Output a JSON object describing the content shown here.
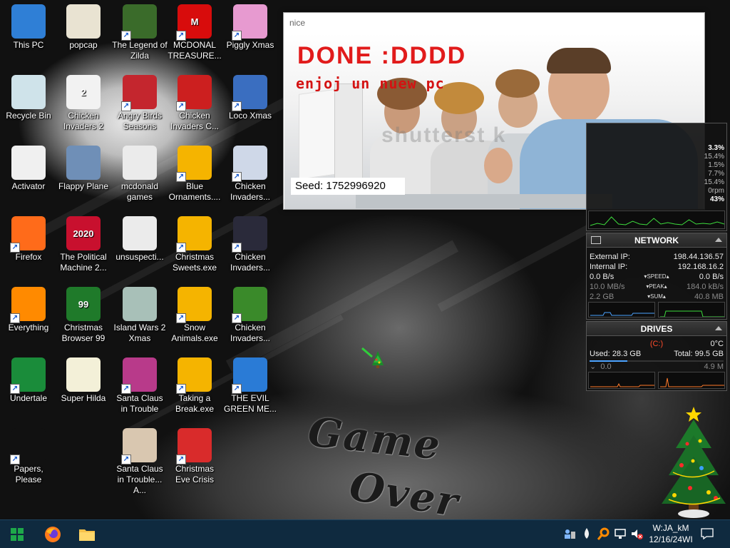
{
  "desktop": {
    "icons": [
      {
        "label": "This PC",
        "icon": "computer-icon",
        "color": "#2f7fd6",
        "glyph": "",
        "shortcut": false
      },
      {
        "label": "Recycle Bin",
        "icon": "recycle-bin-icon",
        "color": "#cfe3ea",
        "glyph": "",
        "shortcut": false
      },
      {
        "label": "Activator",
        "icon": "folder-icon",
        "color": "#f0f0f0",
        "glyph": "",
        "shortcut": false
      },
      {
        "label": "Firefox",
        "icon": "firefox-icon",
        "color": "#ff6b1a",
        "glyph": "",
        "shortcut": true
      },
      {
        "label": "Everything",
        "icon": "search-icon",
        "color": "#ff8a00",
        "glyph": "",
        "shortcut": true
      },
      {
        "label": "Undertale",
        "icon": "undertale-icon",
        "color": "#1a8c3a",
        "glyph": "",
        "shortcut": true
      },
      {
        "label": "Papers, Please",
        "icon": "papers-please-icon",
        "color": "#111111",
        "glyph": "",
        "shortcut": true
      },
      {
        "label": "popcap",
        "icon": "folder-icon",
        "color": "#e9e3d2",
        "glyph": "",
        "shortcut": false
      },
      {
        "label": "Chicken Invaders 2",
        "icon": "chicken-invaders-icon",
        "color": "#f2f2f2",
        "glyph": "2",
        "shortcut": false
      },
      {
        "label": "Flappy Plane",
        "icon": "flappy-plane-icon",
        "color": "#6f8fb7",
        "glyph": "",
        "shortcut": false
      },
      {
        "label": "The Political Machine 2...",
        "icon": "political-machine-icon",
        "color": "#c8102e",
        "glyph": "2020",
        "shortcut": false
      },
      {
        "label": "Christmas Browser 99",
        "icon": "christmas-browser-icon",
        "color": "#1f7a2a",
        "glyph": "99",
        "shortcut": false
      },
      {
        "label": "Super Hilda",
        "icon": "super-hilda-icon",
        "color": "#f3f0d8",
        "glyph": "",
        "shortcut": false
      },
      {
        "label": "The Legend of Zilda",
        "icon": "legend-zilda-icon",
        "color": "#3a6b2a",
        "glyph": "",
        "shortcut": true
      },
      {
        "label": "Angry Birds Seasons",
        "icon": "angry-birds-icon",
        "color": "#c4262e",
        "glyph": "",
        "shortcut": true
      },
      {
        "label": "mcdonald games",
        "icon": "folder-icon",
        "color": "#ebebeb",
        "glyph": "",
        "shortcut": false
      },
      {
        "label": "unsuspecti...",
        "icon": "folder-icon",
        "color": "#ebebeb",
        "glyph": "",
        "shortcut": false
      },
      {
        "label": "Island Wars 2 Xmas",
        "icon": "island-wars-icon",
        "color": "#a8c0b8",
        "glyph": "",
        "shortcut": false
      },
      {
        "label": "Santa Claus in Trouble",
        "icon": "santa-claus-icon",
        "color": "#b83a8a",
        "glyph": "",
        "shortcut": true
      },
      {
        "label": "Santa Claus in Trouble... A...",
        "icon": "santa-claus-icon",
        "color": "#d9c7b0",
        "glyph": "",
        "shortcut": true
      },
      {
        "label": "MCDONAL TREASURE...",
        "icon": "mcdonalds-icon",
        "color": "#d80c0c",
        "glyph": "M",
        "shortcut": true
      },
      {
        "label": "Chicken Invaders C...",
        "icon": "chicken-invaders-icon",
        "color": "#cc1f1f",
        "glyph": "",
        "shortcut": true
      },
      {
        "label": "Blue Ornaments....",
        "icon": "gift-icon",
        "color": "#f5b400",
        "glyph": "",
        "shortcut": true
      },
      {
        "label": "Christmas Sweets.exe",
        "icon": "gift-icon",
        "color": "#f5b400",
        "glyph": "",
        "shortcut": true
      },
      {
        "label": "Snow Animals.exe",
        "icon": "gift-icon",
        "color": "#f5b400",
        "glyph": "",
        "shortcut": true
      },
      {
        "label": "Taking a Break.exe",
        "icon": "gift-icon",
        "color": "#f5b400",
        "glyph": "",
        "shortcut": true
      },
      {
        "label": "Christmas Eve Crisis",
        "icon": "santa-icon",
        "color": "#d92b2b",
        "glyph": "",
        "shortcut": true
      },
      {
        "label": "Piggly Xmas",
        "icon": "piggly-icon",
        "color": "#e79ad0",
        "glyph": "",
        "shortcut": true
      },
      {
        "label": "Loco Xmas",
        "icon": "loco-xmas-icon",
        "color": "#3a6ec0",
        "glyph": "",
        "shortcut": true
      },
      {
        "label": "Chicken Invaders...",
        "icon": "chicken-invaders-icon",
        "color": "#cfd8e8",
        "glyph": "",
        "shortcut": true
      },
      {
        "label": "Chicken Invaders...",
        "icon": "chicken-invaders-icon",
        "color": "#2a2a3a",
        "glyph": "",
        "shortcut": true
      },
      {
        "label": "Chicken Invaders...",
        "icon": "chicken-invaders-icon",
        "color": "#3a8a2a",
        "glyph": "",
        "shortcut": true
      },
      {
        "label": "THE EVIL GREEN ME...",
        "icon": "messenger-icon",
        "color": "#2a7bd6",
        "glyph": "",
        "shortcut": true
      }
    ]
  },
  "popup": {
    "title": "nice",
    "headline": "DONE :DDDD",
    "subline": "enjoj un nuew pc",
    "watermark": "shutterst  k",
    "seed": "Seed: 1752996920"
  },
  "cpu_gadget": {
    "values": [
      "3.3%",
      "15.4%",
      "1.5%",
      "7.7%",
      "15.4%",
      "0rpm",
      "43%"
    ],
    "graph": [
      0.2,
      0.35,
      0.25,
      0.8,
      0.3,
      0.25,
      0.5,
      0.3,
      0.25,
      0.7,
      0.3,
      0.4,
      0.3,
      0.25,
      0.6,
      0.3,
      0.35,
      0.3,
      0.45,
      0.3
    ]
  },
  "network": {
    "title": "NETWORK",
    "external_ip_label": "External IP:",
    "external_ip": "198.44.136.57",
    "internal_ip_label": "Internal IP:",
    "internal_ip": "192.168.16.2",
    "speed_up": "0.0 B/s",
    "speed_label": "SPEED",
    "speed_down": "0.0 B/s",
    "peak_up": "10.0 MB/s",
    "peak_label": "PEAK",
    "peak_down": "184.0 kB/s",
    "sum_up": "2.2 GB",
    "sum_label": "SUM",
    "sum_down": "40.8 MB"
  },
  "drives": {
    "title": "DRIVES",
    "drive_letter": "(C:)",
    "temp": "0°C",
    "used_label": "Used:",
    "used": "28.3 GB",
    "total_label": "Total:",
    "total": "99.5 GB",
    "read": "0.0",
    "write": "4.9 M"
  },
  "taskbar": {
    "clock_time": "W:JA_kM",
    "clock_date": "12/16/24WI",
    "colors": {
      "bg": "#0f2a3f",
      "accent": "#1e90ff"
    }
  },
  "wallpaper": {
    "text_line1": "Game",
    "text_line2": "Over"
  }
}
